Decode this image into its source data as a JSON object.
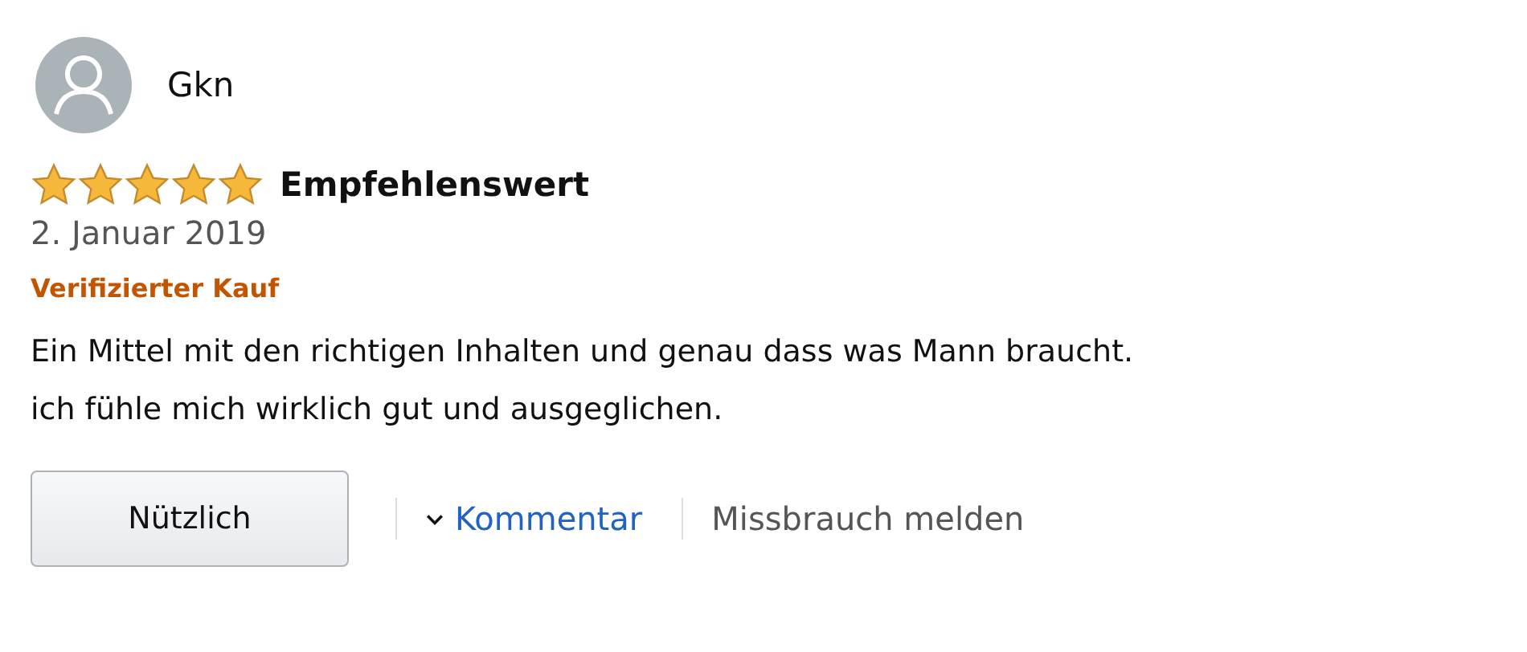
{
  "review": {
    "author": "Gkn",
    "stars": 5,
    "title": "Empfehlenswert",
    "date": "2. Januar 2019",
    "badge": "Verifizierter Kauf",
    "body_lines": [
      "Ein Mittel mit den richtigen Inhalten und genau dass was Mann braucht.",
      "ich fühle mich wirklich gut und ausgeglichen."
    ],
    "helpful_button": "Nützlich",
    "comment_link": "Kommentar",
    "report_link": "Missbrauch melden"
  }
}
